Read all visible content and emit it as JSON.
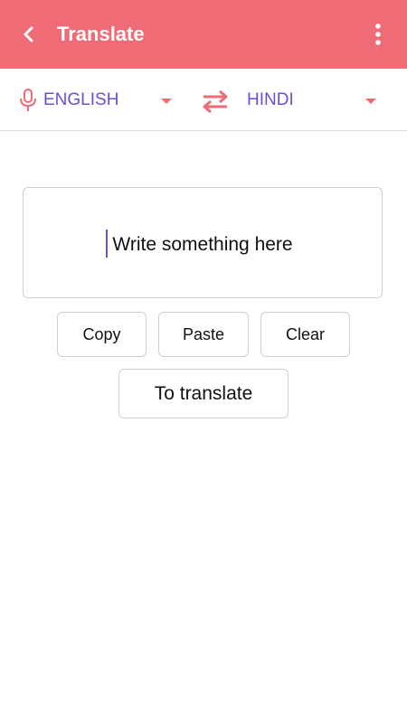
{
  "appbar": {
    "title": "Translate",
    "back_icon": "arrow-back-icon",
    "menu_icon": "more-vert-icon"
  },
  "languages": {
    "source": "ENGLISH",
    "target": "HINDI",
    "mic_icon": "microphone-icon",
    "swap_icon": "swap-arrows-icon",
    "dropdown_icon": "caret-down-icon"
  },
  "input": {
    "placeholder": "Write something here"
  },
  "actions": {
    "copy": "Copy",
    "paste": "Paste",
    "clear": "Clear",
    "translate": "To translate"
  },
  "colors": {
    "accent": "#ef6b75",
    "language_text": "#6a4fd6",
    "caret": "#6a4fd6"
  }
}
